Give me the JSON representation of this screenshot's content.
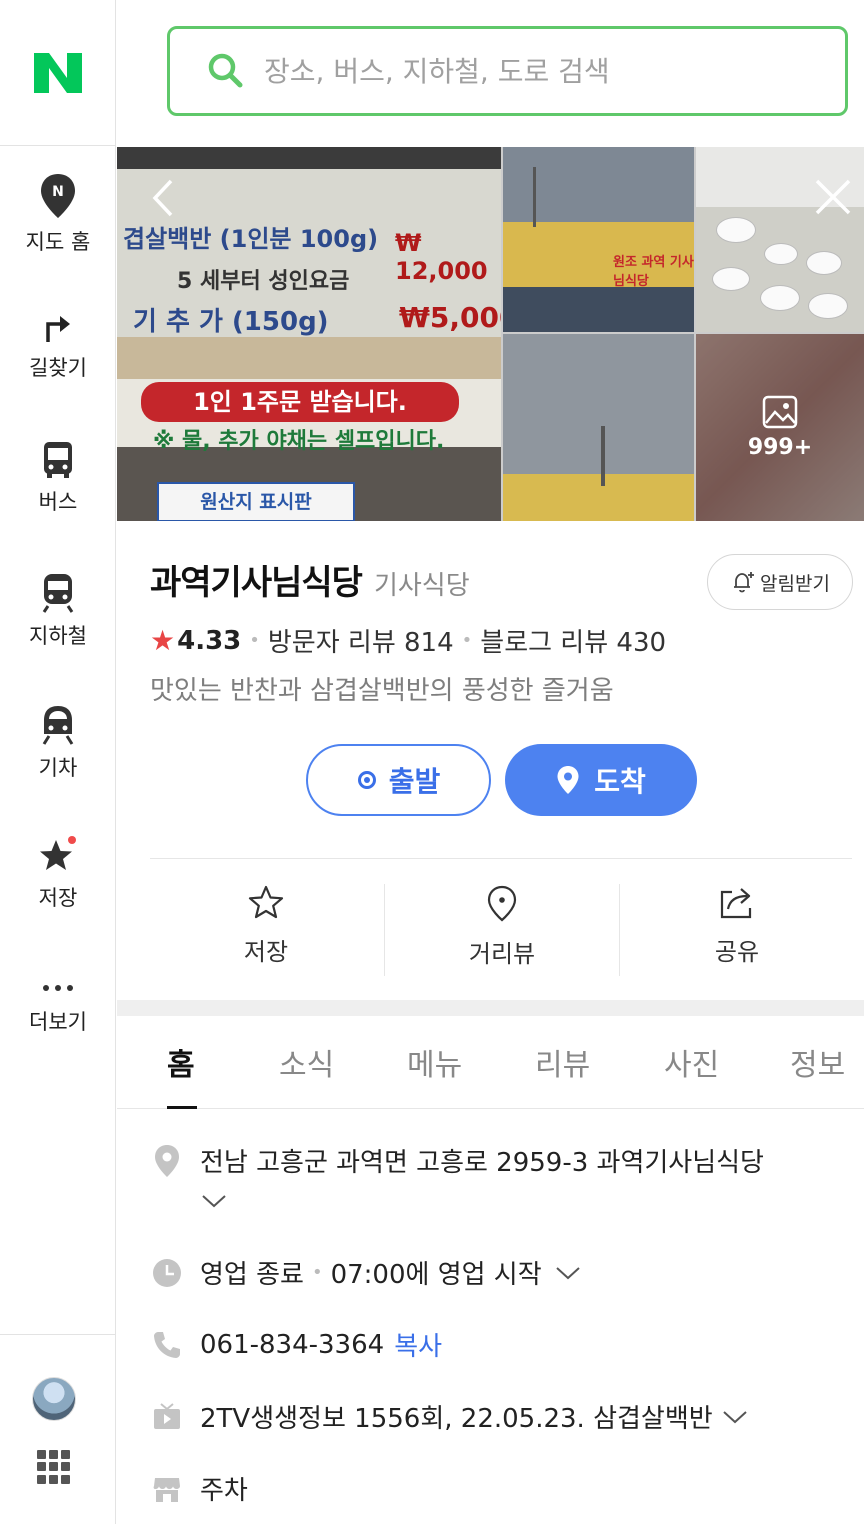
{
  "sidebar": {
    "logo": "N",
    "items": [
      {
        "label": "지도 홈",
        "icon": "map-pin-n-icon"
      },
      {
        "label": "길찾기",
        "icon": "directions-icon"
      },
      {
        "label": "버스",
        "icon": "bus-icon"
      },
      {
        "label": "지하철",
        "icon": "subway-icon"
      },
      {
        "label": "기차",
        "icon": "train-icon"
      },
      {
        "label": "저장",
        "icon": "star-icon"
      },
      {
        "label": "더보기",
        "icon": "more-icon"
      }
    ]
  },
  "search": {
    "placeholder": "장소, 버스, 지하철, 도로 검색"
  },
  "photos": {
    "sign_price_1": "₩ 12,000",
    "sign_price_2": "₩5,000",
    "sign_line_1": "겹살백반 (1인분 100g)",
    "sign_line_2": "5 세부터 성인요금",
    "sign_line_3": "기 추 가 (150g)",
    "sign_pill": "1인 1주문 받습니다.",
    "sign_note": "※ 물, 추가 야채는 셀프입니다.",
    "sign_origin": "원산지 표시판",
    "banner_text": "원조 과역 기사님식당",
    "more_count": "999+"
  },
  "place": {
    "name": "과역기사님식당",
    "category": "기사식당",
    "alarm": "알림받기",
    "rating": "4.33",
    "visitor_reviews": "방문자 리뷰 814",
    "blog_reviews": "블로그 리뷰 430",
    "description": "맛있는 반찬과 삼겹살백반의 풍성한 즐거움"
  },
  "route": {
    "depart": "출발",
    "arrive": "도착"
  },
  "actions": {
    "save": "저장",
    "streetview": "거리뷰",
    "share": "공유"
  },
  "tabs": [
    "홈",
    "소식",
    "메뉴",
    "리뷰",
    "사진",
    "정보"
  ],
  "info": {
    "address": "전남 고흥군 과역면 고흥로 2959-3 과역기사님식당",
    "hours_status": "영업 종료",
    "hours_next": "07:00에 영업 시작",
    "phone": "061-834-3364",
    "copy": "복사",
    "tv": "2TV생생정보 1556회, 22.05.23. 삼겹살백반",
    "parking": "주차"
  },
  "colors": {
    "brand_green": "#03c75a",
    "accent_blue": "#4d82f0",
    "rating_red": "#e84545"
  }
}
